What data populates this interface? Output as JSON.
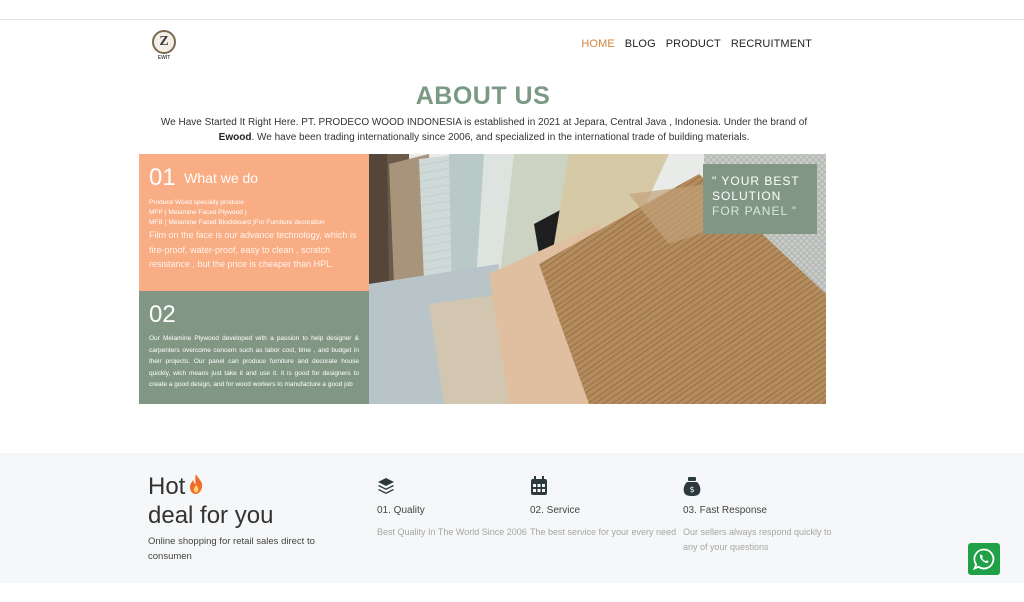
{
  "header": {
    "logo_text": "Z",
    "logo_brand": "EWIT",
    "nav": [
      {
        "label": "HOME",
        "active": true
      },
      {
        "label": "BLOG",
        "active": false
      },
      {
        "label": "PRODUCT",
        "active": false
      },
      {
        "label": "RECRUITMENT",
        "active": false
      }
    ]
  },
  "about": {
    "title": "ABOUT US",
    "text_before": "We Have Started It Right Here. PT. PRODECO WOOD INDONESIA is established in 2021 at Jepara, Central Java , Indonesia. Under the brand of ",
    "brand": "Ewood",
    "text_after": ". We have been trading internationally since 2006, and specialized in the international trade of building materials."
  },
  "box1": {
    "number": "01",
    "title": "What we do",
    "line1": "Produce Wood specially produce",
    "line2": "MFP ( Melamine Faced Plywood )",
    "line3": "MFB ( Melamine Faced Blockboard )For Furniture decoration",
    "description": "Film on the face is our advance technology, which is fire-proof, water-proof, easy to clean , scratch resistance , but the price is cheaper than HPL."
  },
  "box2": {
    "number": "02",
    "description": "Our Melamine Plywood developed with a passion to help designer & carpenters overcome concern such as labor cost, time , and budget in their projects. Our panel can produce furniture and decorate house quickly, wich means just take it and use it. it is good for designers to create a good design, and for wood workers to manufacture a good job"
  },
  "tagline": {
    "line1": "\" YOUR BEST",
    "line2": "SOLUTION",
    "line3": "FOR PANEL \""
  },
  "hot": {
    "line1": "Hot",
    "line2": "deal for you",
    "subtitle": "Online shopping for retail sales direct to consumen"
  },
  "features": [
    {
      "icon": "layers-icon",
      "title": "01. Quality",
      "description": "Best Quality In The World Since 2006"
    },
    {
      "icon": "calendar-icon",
      "title": "02. Service",
      "description": "The best service for your every need"
    },
    {
      "icon": "money-bag-icon",
      "title": "03. Fast Response",
      "description": "Our sellers always respond quickly to any of your questions"
    }
  ],
  "colors": {
    "accent_orange": "#f9ad84",
    "accent_green": "#819784",
    "nav_active": "#d3843f",
    "whatsapp": "#21a147"
  }
}
